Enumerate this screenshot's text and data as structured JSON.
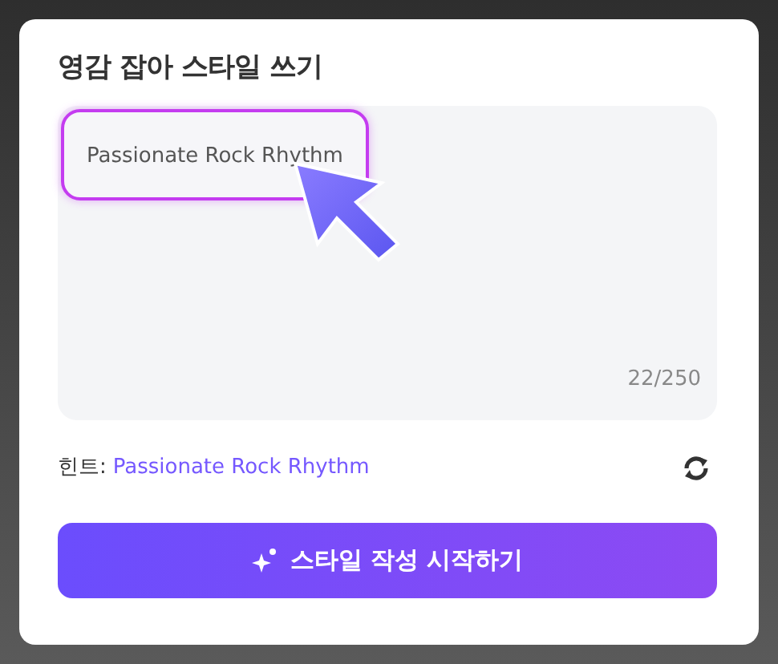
{
  "title": "영감 잡아 스타일 쓰기",
  "prompt": {
    "value": "Passionate Rock Rhythm",
    "counter": "22/250"
  },
  "hint": {
    "label": "힌트:",
    "value": "Passionate Rock Rhythm"
  },
  "button": {
    "label": "스타일 작성 시작하기"
  }
}
